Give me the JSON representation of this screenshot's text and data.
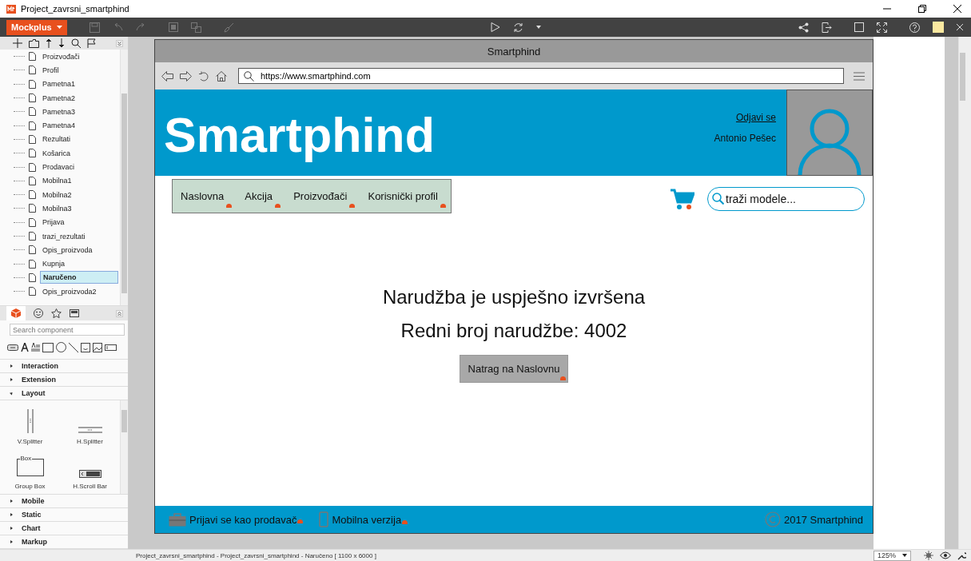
{
  "app": {
    "title": "Project_zavrsni_smartphind",
    "menu_button": "Mockplus"
  },
  "page_tree": {
    "items": [
      {
        "label": "Proizvođači",
        "selected": false
      },
      {
        "label": "Profil",
        "selected": false
      },
      {
        "label": "Pametna1",
        "selected": false
      },
      {
        "label": "Pametna2",
        "selected": false
      },
      {
        "label": "Pametna3",
        "selected": false
      },
      {
        "label": "Pametna4",
        "selected": false
      },
      {
        "label": "Rezultati",
        "selected": false
      },
      {
        "label": "Košarica",
        "selected": false
      },
      {
        "label": "Prodavaci",
        "selected": false
      },
      {
        "label": "Mobilna1",
        "selected": false
      },
      {
        "label": "Mobilna2",
        "selected": false
      },
      {
        "label": "Mobilna3",
        "selected": false
      },
      {
        "label": "Prijava",
        "selected": false
      },
      {
        "label": "trazi_rezultati",
        "selected": false
      },
      {
        "label": "Opis_proizvoda",
        "selected": false
      },
      {
        "label": "Kupnja",
        "selected": false
      },
      {
        "label": "Naručeno",
        "selected": true
      },
      {
        "label": "Opis_proizvoda2",
        "selected": false
      }
    ]
  },
  "component_panel": {
    "search": {
      "placeholder": "Search component"
    },
    "categories": [
      {
        "label": "Interaction",
        "expanded": false
      },
      {
        "label": "Extension",
        "expanded": false
      },
      {
        "label": "Layout",
        "expanded": true,
        "items": [
          {
            "label": "V.Splitter",
            "kind": "vsplitter"
          },
          {
            "label": "H.Splitter",
            "kind": "hsplitter"
          },
          {
            "label": "Group Box",
            "kind": "groupbox",
            "caption": "Box"
          },
          {
            "label": "H.Scroll Bar",
            "kind": "hscroll"
          }
        ]
      },
      {
        "label": "Mobile",
        "expanded": false
      },
      {
        "label": "Static",
        "expanded": false
      },
      {
        "label": "Chart",
        "expanded": false
      },
      {
        "label": "Markup",
        "expanded": false
      }
    ]
  },
  "mockup": {
    "window_title": "Smartphind",
    "url": "https://www.smartphind.com",
    "logo": "Smartphind",
    "logout_link": "Odjavi se",
    "user_name": "Antonio Pešec",
    "nav": [
      "Naslovna",
      "Akcija",
      "Proizvođači",
      "Korisnički profil"
    ],
    "search": {
      "placeholder": "traži modele..."
    },
    "messages": [
      "Narudžba je uspješno izvršena",
      "Redni broj narudžbe: 4002"
    ],
    "back_button": "Natrag na Naslovnu",
    "footer": {
      "links": [
        {
          "label": "Prijavi se kao prodavač",
          "kind": "briefcase"
        },
        {
          "label": "Mobilna verzija",
          "kind": "phone"
        }
      ],
      "copyright": "2017 Smartphind"
    }
  },
  "status_bar": {
    "path": "Project_zavrsni_smartphind - Project_zavrsni_smartphind - Naručeno [ 1100 x 6000 ]",
    "zoom": "125%"
  }
}
